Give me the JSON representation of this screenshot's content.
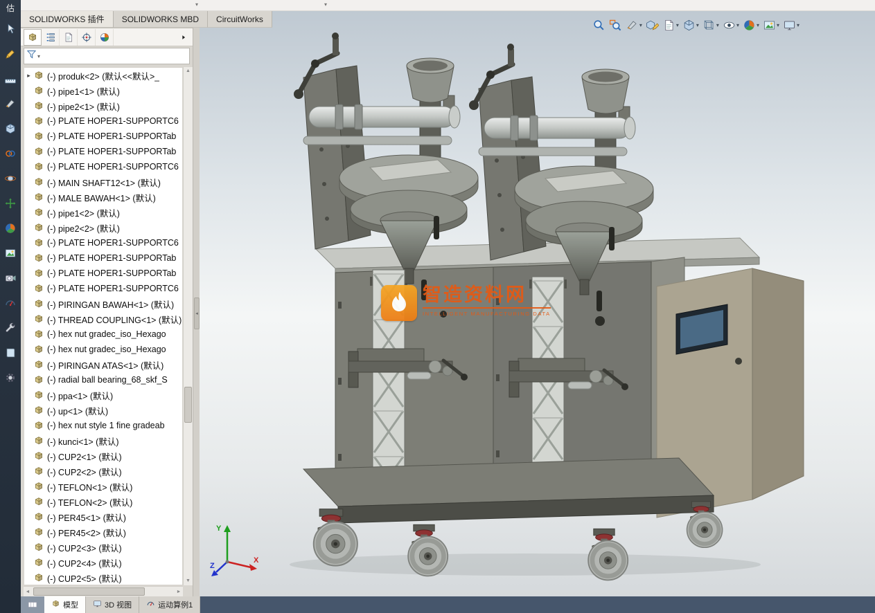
{
  "left_toolbar": {
    "top_label": "估",
    "icons": [
      "select-tool-icon",
      "sketch-tool-icon",
      "measure-tool-icon",
      "section-tool-icon",
      "component-tool-icon",
      "mate-tool-icon",
      "rotate-view-icon",
      "move-component-icon",
      "appearance-tool-icon",
      "scene-tool-icon",
      "camera-tool-icon",
      "evaluate-tool-icon",
      "toolbox-icon",
      "design-library-icon",
      "options-icon"
    ]
  },
  "ribbon_tabs": [
    {
      "label": "SOLIDWORKS 插件"
    },
    {
      "label": "SOLIDWORKS MBD"
    },
    {
      "label": "CircuitWorks"
    }
  ],
  "feature_panel": {
    "tabs": [
      {
        "name": "featuremanager-tab",
        "active": true
      },
      {
        "name": "propertymanager-tab"
      },
      {
        "name": "configurationmanager-tab"
      },
      {
        "name": "dimxpert-tab"
      },
      {
        "name": "displaymanager-tab"
      }
    ],
    "items": [
      {
        "label": "(-) produk<2> (默认<<默认>_",
        "arrow": true
      },
      {
        "label": "(-) pipe1<1> (默认)"
      },
      {
        "label": "(-) pipe2<1> (默认)"
      },
      {
        "label": "(-) PLATE HOPER1-SUPPORTC6"
      },
      {
        "label": "(-) PLATE HOPER1-SUPPORTab"
      },
      {
        "label": "(-) PLATE HOPER1-SUPPORTab"
      },
      {
        "label": "(-) PLATE HOPER1-SUPPORTC6"
      },
      {
        "label": "(-) MAIN SHAFT12<1> (默认)"
      },
      {
        "label": "(-) MALE BAWAH<1> (默认)"
      },
      {
        "label": "(-) pipe1<2> (默认)"
      },
      {
        "label": "(-) pipe2<2> (默认)"
      },
      {
        "label": "(-) PLATE HOPER1-SUPPORTC6"
      },
      {
        "label": "(-) PLATE HOPER1-SUPPORTab"
      },
      {
        "label": "(-) PLATE HOPER1-SUPPORTab"
      },
      {
        "label": "(-) PLATE HOPER1-SUPPORTC6"
      },
      {
        "label": "(-) PIRINGAN BAWAH<1> (默认)"
      },
      {
        "label": "(-) THREAD COUPLING<1> (默认)"
      },
      {
        "label": "(-) hex nut gradec_iso_Hexago"
      },
      {
        "label": "(-) hex nut gradec_iso_Hexago"
      },
      {
        "label": "(-) PIRINGAN ATAS<1> (默认)"
      },
      {
        "label": "(-) radial ball bearing_68_skf_S"
      },
      {
        "label": "(-) ppa<1> (默认)"
      },
      {
        "label": "(-) up<1> (默认)"
      },
      {
        "label": "(-) hex nut style 1 fine gradeab"
      },
      {
        "label": "(-) kunci<1> (默认)"
      },
      {
        "label": "(-) CUP2<1> (默认)"
      },
      {
        "label": "(-) CUP2<2> (默认)"
      },
      {
        "label": "(-) TEFLON<1> (默认)"
      },
      {
        "label": "(-) TEFLON<2> (默认)"
      },
      {
        "label": "(-) PER45<1> (默认)"
      },
      {
        "label": "(-) PER45<2> (默认)"
      },
      {
        "label": "(-) CUP2<3> (默认)"
      },
      {
        "label": "(-) CUP2<4> (默认)"
      },
      {
        "label": "(-) CUP2<5> (默认)"
      }
    ]
  },
  "viewport": {
    "hud": [
      {
        "name": "zoom-fit-icon"
      },
      {
        "name": "zoom-area-icon"
      },
      {
        "name": "section-view-icon",
        "dropdown": true
      },
      {
        "name": "drawing-view-icon"
      },
      {
        "name": "annotation-view-icon",
        "dropdown": true
      },
      {
        "name": "view-orientation-icon",
        "dropdown": true
      },
      {
        "name": "display-style-icon",
        "dropdown": true
      },
      {
        "name": "hide-show-items-icon",
        "dropdown": true
      },
      {
        "name": "edit-appearance-icon",
        "dropdown": true
      },
      {
        "name": "apply-scene-icon",
        "dropdown": true
      },
      {
        "name": "view-settings-icon",
        "dropdown": true
      }
    ],
    "watermark": {
      "title": "智造资料网",
      "subtitle": "INTELLIGENT MANUFACTURING DATA"
    },
    "triad": {
      "x_label": "X",
      "y_label": "Y",
      "z_label": "Z"
    }
  },
  "status_bar": {
    "tabs": [
      {
        "label": "模型"
      },
      {
        "label": "3D 视图"
      },
      {
        "label": "运动算例1"
      }
    ]
  },
  "colors": {
    "watermark_orange": "#e55a14",
    "machine_gray": "#8b8c84",
    "cabinet_khaki": "#aba491"
  }
}
